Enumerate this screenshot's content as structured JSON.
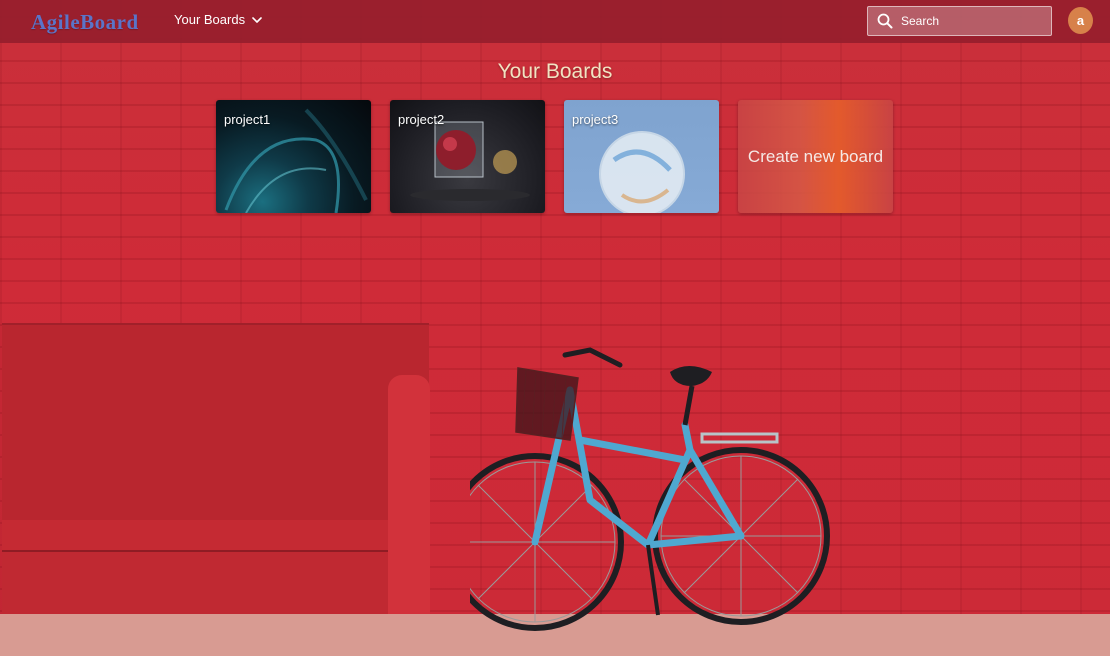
{
  "app": {
    "logo": "AgileBoard"
  },
  "nav": {
    "boards_label": "Your Boards"
  },
  "search": {
    "placeholder": "Search",
    "value": ""
  },
  "user": {
    "avatar_letter": "a"
  },
  "page": {
    "heading": "Your Boards"
  },
  "boards": [
    {
      "name": "project1"
    },
    {
      "name": "project2"
    },
    {
      "name": "project3"
    }
  ],
  "create_board": {
    "label": "Create new board"
  },
  "colors": {
    "navbar": "#961e2d",
    "logo": "#5b74c8",
    "avatar": "#d7814a",
    "heading": "#f1e3c2",
    "wall": "#cc2a37",
    "bicycle": "#4fa8d0"
  }
}
